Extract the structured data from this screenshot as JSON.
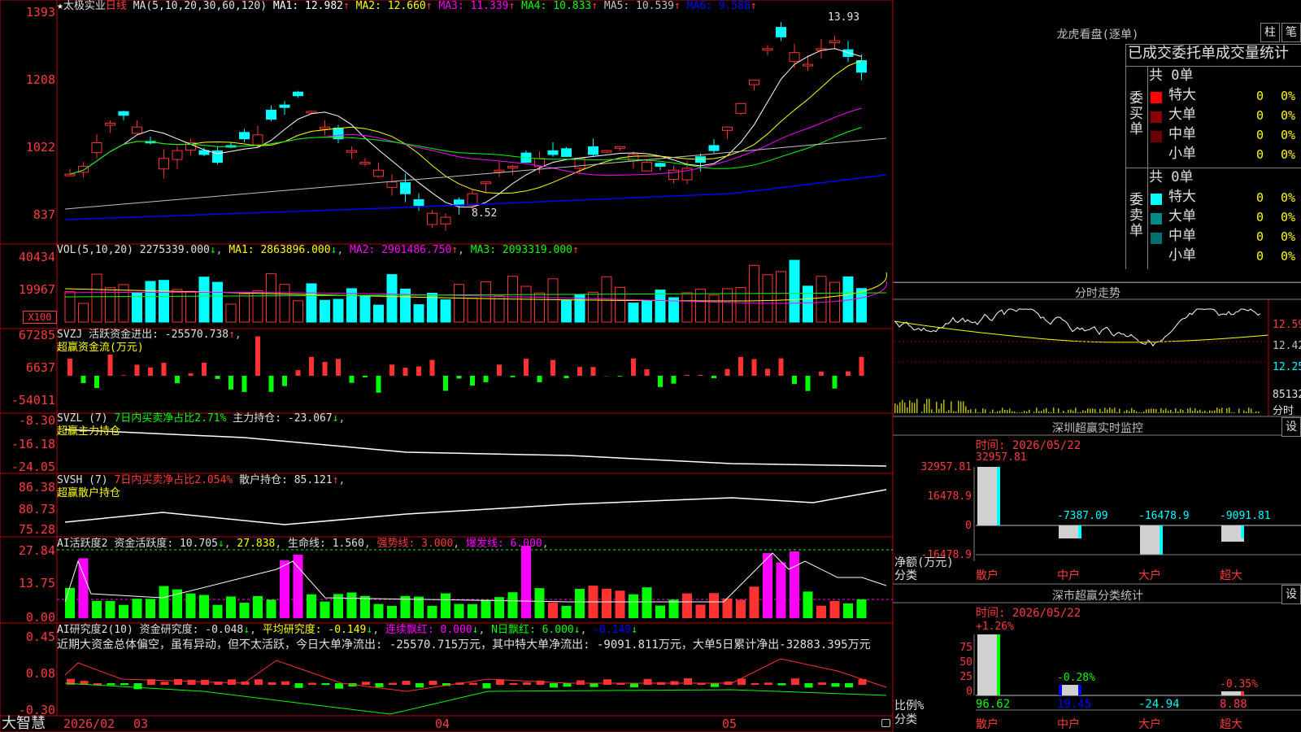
{
  "brand": {
    "name": "大智慧",
    "star": "★"
  },
  "stock": {
    "name": "太极实业",
    "period": "日线"
  },
  "ma_header": {
    "params": "MA(5,10,20,30,60,120)",
    "items": [
      {
        "label": "MA1: 12.982",
        "color": "#ffffff"
      },
      {
        "label": "MA2: 12.660",
        "color": "#ffff00"
      },
      {
        "label": "MA3: 11.339",
        "color": "#ff00ff"
      },
      {
        "label": "MA4: 10.833",
        "color": "#00ff00"
      },
      {
        "label": "MA5: 10.539",
        "color": "#c0c0c0"
      },
      {
        "label": "MA6: 9.588",
        "color": "#0000ff"
      }
    ],
    "up_arrow": "↑",
    "down_arrow": "↓"
  },
  "price_axis": [
    "1393",
    "1208",
    "1022",
    "837"
  ],
  "price_high_label": "13.93",
  "price_low_label": "8.52",
  "vol_header": {
    "params": "VOL(5,10,20)",
    "value": "2275339.000",
    "ma1": "MA1: 2863896.000",
    "ma2": "MA2: 2901486.750",
    "ma3": "MA3: 2093319.000"
  },
  "vol_axis": [
    "40434",
    "19967"
  ],
  "vol_unit": "X100",
  "svzj": {
    "name": "SVZJ",
    "label": "活跃资金进出: -25570.738",
    "sub": "超赢资金流(万元)",
    "axis": [
      "67285",
      "6637",
      "-54011"
    ]
  },
  "svzl": {
    "name": "SVZL (7)",
    "label1": "7日内买卖净占比2.71%",
    "label2": "主力持仓: -23.067",
    "sub": "超赢主力持仓",
    "axis": [
      "-8.30",
      "-16.18",
      "-24.05"
    ]
  },
  "svsh": {
    "name": "SVSH (7)",
    "label1": "7日内买卖净占比2.054%",
    "label2": "散户持仓: 85.121",
    "sub": "超赢散户持仓",
    "axis": [
      "86.38",
      "80.73",
      "75.28"
    ]
  },
  "ai_active": {
    "name": "AI活跃度2",
    "label1": "资金活跃度: 10.705",
    "label2": "27.838",
    "label3": "生命线: 1.560",
    "label4": "强势线: 3.000",
    "label5": "爆发线: 6.000",
    "axis": [
      "27.84",
      "13.75",
      "0.00"
    ]
  },
  "ai_research": {
    "name": "AI研究度2(10)",
    "label1": "资金研究度: -0.048",
    "label2": "平均研究度: -0.149",
    "label3": "连续飘红: 0.000",
    "label4": "N日飘红: 6.000",
    "label5": "-0.149",
    "desc": "近期大资金总体偏空，虽有异动，但不太活跃，今日大单净流出: -25570.715万元，其中特大单净流出: -9091.811万元，大单5日累计净出-32883.395万元",
    "axis": [
      "0.45",
      "0.08",
      "-0.30"
    ]
  },
  "date_axis": [
    "2026/02",
    "03",
    "04",
    "05"
  ],
  "dragon": {
    "title": "龙虎看盘(逐单)",
    "btn_bar": "柱",
    "btn_order": "笔",
    "table_title": "已成交委托单成交量统计",
    "buy": {
      "side": "委买单",
      "total": "共 0单",
      "rows": [
        {
          "name": "特大",
          "count": "0",
          "pct": "0%",
          "color": "#ff0000"
        },
        {
          "name": "大单",
          "count": "0",
          "pct": "0%",
          "color": "#8b0000"
        },
        {
          "name": "中单",
          "count": "0",
          "pct": "0%",
          "color": "#6b0000"
        },
        {
          "name": "小单",
          "count": "0",
          "pct": "0%",
          "color": "#000000"
        }
      ]
    },
    "sell": {
      "side": "委卖单",
      "total": "共 0单",
      "rows": [
        {
          "name": "特大",
          "count": "0",
          "pct": "0%",
          "color": "#00ffff"
        },
        {
          "name": "大单",
          "count": "0",
          "pct": "0%",
          "color": "#008b8b"
        },
        {
          "name": "中单",
          "count": "0",
          "pct": "0%",
          "color": "#007070"
        },
        {
          "name": "小单",
          "count": "0",
          "pct": "0%",
          "color": "#000000"
        }
      ]
    }
  },
  "intraday": {
    "title": "分时走势",
    "axis": [
      "12.59",
      "12.42",
      "12.25",
      "85132",
      "分时"
    ]
  },
  "sz_monitor": {
    "title": "深圳超赢实时监控",
    "btn": "设",
    "time": "时间: 2026/05/22",
    "axis": [
      "32957.81",
      "16478.9",
      "0",
      "-16478.9"
    ],
    "ylabel": "净额(万元)",
    "xlabel": "分类",
    "bars": [
      {
        "cat": "散户",
        "value": "32957.81"
      },
      {
        "cat": "中户",
        "value": "-7387.09"
      },
      {
        "cat": "大户",
        "value": "-16478.9"
      },
      {
        "cat": "超大",
        "value": "-9091.81"
      }
    ]
  },
  "sz_class": {
    "title": "深市超赢分类统计",
    "btn": "设",
    "time": "时间: 2026/05/22",
    "axis": [
      "75",
      "50",
      "25",
      "0"
    ],
    "ylabel": "比例%",
    "xlabel": "分类",
    "bars": [
      {
        "cat": "散户",
        "top": "+1.26%",
        "bottom": "96.62"
      },
      {
        "cat": "中户",
        "top": "-0.28%",
        "bottom": "19.45"
      },
      {
        "cat": "大户",
        "top": "",
        "bottom": "-24.94"
      },
      {
        "cat": "超大",
        "top": "-0.35%",
        "bottom": "8.88"
      }
    ]
  },
  "colors": {
    "up": "#ff3232",
    "down": "#00ffff",
    "grid": "#8b0000",
    "frame": "#c00000"
  }
}
